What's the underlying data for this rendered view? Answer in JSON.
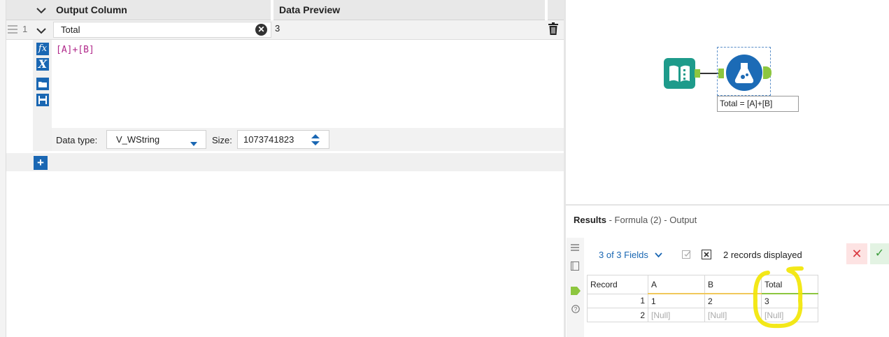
{
  "formula_panel": {
    "header": {
      "output_column_label": "Output Column",
      "data_preview_label": "Data Preview"
    },
    "row": {
      "number": "1",
      "output_column": "Total",
      "preview_value": "3",
      "expression": "[A]+[B]"
    },
    "data_type": {
      "label": "Data type:",
      "value": "V_WString"
    },
    "size": {
      "label": "Size:",
      "value": "1073741823"
    }
  },
  "canvas": {
    "formula_tool_annotation": "Total = [A]+[B]",
    "tool_colors": {
      "input": "#1e9b8b",
      "formula": "#1c6bb6",
      "connection": "#8dc63f"
    }
  },
  "results": {
    "title_bold": "Results",
    "title_rest": " - Formula (2) - Output",
    "fields_selector": "3 of 3 Fields",
    "records_displayed": "2 records displayed",
    "columns": [
      "Record",
      "A",
      "B",
      "Total"
    ],
    "rows": [
      [
        "1",
        "1",
        "2",
        "3"
      ],
      [
        "2",
        "[Null]",
        "[Null]",
        "[Null]"
      ]
    ]
  },
  "colors": {
    "accent": "#1a67b3",
    "highlight": "#f2e600"
  }
}
